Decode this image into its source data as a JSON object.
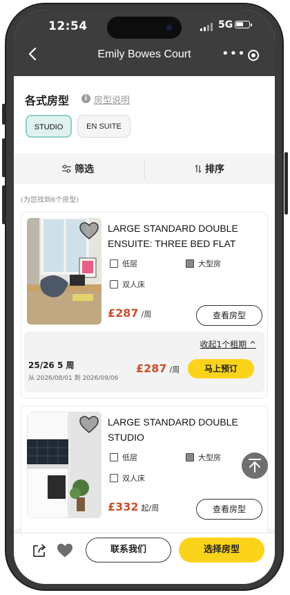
{
  "status": {
    "time": "12:54",
    "network": "5G"
  },
  "nav": {
    "title": "Emily Bowes Court",
    "more_glyph": "•••"
  },
  "section": {
    "title": "各式房型",
    "info_link": "房型说明",
    "info_glyph": "i"
  },
  "chips": [
    {
      "label": "STUDIO",
      "selected": true
    },
    {
      "label": "EN SUITE",
      "selected": false
    }
  ],
  "filters": {
    "filter_label": "筛选",
    "sort_label": "排序"
  },
  "result_text": "(为您找到6个房型)",
  "rooms": [
    {
      "name": "LARGE STANDARD DOUBLE ENSUITE: THREE BED FLAT",
      "features": [
        "低层",
        "大型房",
        "双人床"
      ],
      "price": "£287",
      "price_unit": "/周",
      "view_button": "查看房型",
      "tenancy": {
        "toggle_label": "收起1个租期",
        "toggle_glyph": "^",
        "weeks": "25/26  5 周",
        "dates": "从  2026/08/01  到  2026/09/06",
        "price": "£287",
        "price_unit": "/周",
        "book_button": "马上预订"
      }
    },
    {
      "name": "LARGE STANDARD DOUBLE STUDIO",
      "features": [
        "低层",
        "大型房",
        "双人床"
      ],
      "price": "£332",
      "price_unit": "起/周",
      "view_button": "查看房型"
    }
  ],
  "bottom": {
    "contact_button": "联系我们",
    "select_button": "选择房型"
  },
  "icons": {
    "back": "back-arrow-icon",
    "share": "share-icon",
    "favorite": "heart-icon",
    "scroll_top": "arrow-up-icon",
    "filter": "sliders-icon",
    "sort": "sort-arrows-icon"
  },
  "colors": {
    "accent_yellow": "#fcd31b",
    "price_red": "#c8502a",
    "chip_active_bg": "#dff2ef",
    "topbar": "#3d3d3d"
  }
}
